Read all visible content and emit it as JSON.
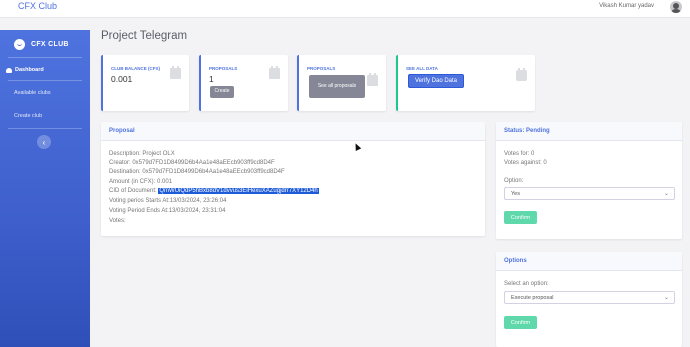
{
  "topbar": {
    "brand": "CFX Club",
    "user_name": "Vikash Kumar yadav"
  },
  "sidebar": {
    "brand": "CFX CLUB",
    "items": [
      {
        "label": "Dashboard"
      },
      {
        "label": "Available clubs"
      },
      {
        "label": "Create club"
      }
    ],
    "toggle_icon": "chevron-left-icon"
  },
  "page": {
    "title": "Project Telegram"
  },
  "cards": [
    {
      "label": "CLUB BALANCE (CFX)",
      "value": "0.001",
      "icon": "calendar-icon"
    },
    {
      "label": "PROPOSALS",
      "value": "1",
      "button": "Create",
      "icon": "calendar-icon"
    },
    {
      "label": "PROPOSALS",
      "button": "See all proposals",
      "icon": "calendar-icon"
    },
    {
      "label": "SEE ALL DATA",
      "button": "Verify Dao Data",
      "icon": "clipboard-icon"
    }
  ],
  "proposal": {
    "header": "Proposal",
    "description_label": "Description: ",
    "description": "Project OLX",
    "creator_label": "Creator: ",
    "creator": "0x579d7FD1D8499D6b4Aa1e48aEEcb903ff9cd8D4F",
    "destination_label": "Destination: ",
    "destination": "0x579d7FD1D8499D6b4Aa1e48aEEcb903ff9cd8D4F",
    "amount_label": "Amount (in CFX): ",
    "amount": "0.001",
    "cid_label": "CID of Document: ",
    "cid": "QmWUiQdP5hBxb8dV1dvvus3EiHexuXAZugjdrr7XY12D4h",
    "start_label": "Voting perios Starts At:",
    "start": "13/03/2024, 23:26:04",
    "end_label": "Voting Period Ends At:",
    "end": "13/03/2024, 23:31:04",
    "votes_label": "Votes:"
  },
  "status": {
    "header": "Status: Pending",
    "votes_for_label": "Votes for: ",
    "votes_for": "0",
    "votes_against_label": "Votes against: ",
    "votes_against": "0",
    "option_label": "Option:",
    "option_value": "Yes",
    "confirm": "Confirm"
  },
  "options": {
    "header": "Options",
    "select_label": "Select an option:",
    "select_value": "Execute proposal",
    "confirm": "Confirm"
  },
  "colors": {
    "primary": "#4e73df",
    "success": "#1cc88a",
    "secondary": "#858796",
    "highlight": "#1e5bd8"
  }
}
